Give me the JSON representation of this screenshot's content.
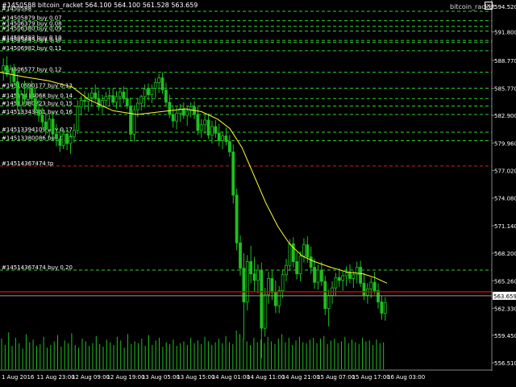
{
  "header": {
    "symbol_line": "#1450588 bitcoin_racket 564.100 564.100 561.528 563.659",
    "close_glyph": "×"
  },
  "watermark": "bitcoin_racket",
  "colors": {
    "background": "#000000",
    "candle": "#1fc01f",
    "volume": "#1fc01f",
    "moving_average": "#ffff33",
    "buy_line": "#33cc33",
    "stop_line": "#cc2222",
    "bid_line": "#d40000",
    "ask_line": "#999999",
    "order_label": "#ffffff"
  },
  "chart_data": {
    "type": "line",
    "y_ticks": [
      "594.520",
      "591.800",
      "588.770",
      "585.770",
      "582.900",
      "579.960",
      "577.020",
      "574.080",
      "571.140",
      "568.200",
      "565.260",
      "563.659",
      "562.330",
      "559.450",
      "556.510"
    ],
    "ylim": [
      556.51,
      594.52
    ],
    "x_ticks": [
      "1 Aug 2016",
      "11 Aug 23:00",
      "12 Aug 09:00",
      "12 Aug 19:00",
      "13 Aug 05:00",
      "13 Aug 15:00",
      "14 Aug 01:00",
      "14 Aug 11:00",
      "14 Aug 21:00",
      "15 Aug 07:00",
      "15 Aug 17:00",
      "16 Aug 03:00"
    ],
    "current_price": 563.659,
    "orders": [
      {
        "label": "#1450588",
        "price": 594.0
      },
      {
        "label": "#14505879 buy 0.07",
        "price": 593.0
      },
      {
        "label": "#14506379 buy 0.08",
        "price": 592.4
      },
      {
        "label": "#14506380 buy 0.09",
        "price": 591.9
      },
      {
        "label": "#14506383 buy 0.10",
        "price": 590.9
      },
      {
        "label": "#14505845 buy 0.10",
        "price": 590.7
      },
      {
        "label": "#14506982 buy 0.11",
        "price": 589.8
      },
      {
        "label": "#14506577 buy 0.12",
        "price": 587.5
      },
      {
        "label": "#14510590177 buy 0.13",
        "price": 585.8
      },
      {
        "label": "#14513414068 buy 0.14",
        "price": 584.7
      },
      {
        "label": "#14513380223 buy 0.15",
        "price": 583.9
      },
      {
        "label": "#14513343461 buy 0.16",
        "price": 583.0
      },
      {
        "label": "#14513394109 buy 0.17",
        "price": 581.1
      },
      {
        "label": "#14513380086 buy 0.18",
        "price": 580.2
      },
      {
        "label": "#14514367474 tp",
        "price": 577.5
      },
      {
        "label": "#14514367474 buy 0.20",
        "price": 566.4
      }
    ],
    "moving_average": [
      [
        0,
        587.5
      ],
      [
        30,
        587.0
      ],
      [
        60,
        586.6
      ],
      [
        90,
        585.9
      ],
      [
        110,
        584.6
      ],
      [
        140,
        583.4
      ],
      [
        170,
        583.0
      ],
      [
        200,
        583.3
      ],
      [
        230,
        583.6
      ],
      [
        250,
        583.3
      ],
      [
        270,
        582.5
      ],
      [
        285,
        581.5
      ],
      [
        300,
        579.5
      ],
      [
        315,
        576.5
      ],
      [
        330,
        573.5
      ],
      [
        345,
        571.0
      ],
      [
        360,
        569.1
      ],
      [
        375,
        567.9
      ],
      [
        390,
        567.3
      ],
      [
        410,
        566.7
      ],
      [
        430,
        566.2
      ],
      [
        450,
        566.0
      ],
      [
        465,
        565.6
      ],
      [
        480,
        565.0
      ]
    ],
    "candles": [
      [
        587.6,
        589.0,
        586.6,
        588.2
      ],
      [
        588.2,
        589.2,
        587.0,
        587.3
      ],
      [
        587.3,
        588.3,
        586.1,
        587.8
      ],
      [
        587.8,
        588.4,
        586.1,
        586.5
      ],
      [
        586.5,
        587.3,
        583.4,
        584.0
      ],
      [
        584.0,
        585.6,
        582.9,
        585.1
      ],
      [
        585.1,
        586.6,
        584.1,
        584.6
      ],
      [
        584.6,
        586.4,
        583.9,
        585.8
      ],
      [
        585.8,
        586.6,
        584.3,
        584.7
      ],
      [
        584.7,
        585.7,
        583.0,
        583.5
      ],
      [
        583.5,
        584.6,
        582.2,
        582.9
      ],
      [
        582.9,
        583.7,
        581.6,
        582.2
      ],
      [
        582.2,
        583.2,
        580.8,
        581.4
      ],
      [
        581.4,
        583.1,
        580.6,
        582.5
      ],
      [
        582.5,
        583.3,
        580.2,
        580.9
      ],
      [
        580.9,
        582.0,
        579.6,
        580.4
      ],
      [
        580.4,
        581.5,
        579.0,
        579.7
      ],
      [
        579.7,
        581.5,
        579.3,
        580.9
      ],
      [
        580.9,
        581.6,
        579.2,
        579.9
      ],
      [
        579.9,
        581.0,
        578.8,
        580.6
      ],
      [
        580.6,
        582.0,
        580.0,
        581.3
      ],
      [
        581.3,
        584.5,
        580.9,
        583.8
      ],
      [
        583.8,
        585.0,
        582.9,
        584.5
      ],
      [
        584.5,
        585.5,
        583.5,
        584.4
      ],
      [
        584.4,
        585.3,
        583.3,
        584.8
      ],
      [
        584.8,
        585.7,
        583.9,
        585.3
      ],
      [
        585.3,
        586.2,
        584.4,
        584.7
      ],
      [
        584.7,
        585.6,
        583.4,
        583.8
      ],
      [
        583.8,
        585.1,
        583.1,
        584.5
      ],
      [
        584.5,
        585.4,
        583.7,
        584.9
      ],
      [
        584.9,
        585.7,
        583.9,
        585.0
      ],
      [
        585.0,
        585.8,
        584.0,
        584.3
      ],
      [
        584.3,
        585.5,
        583.6,
        584.9
      ],
      [
        584.9,
        585.8,
        583.8,
        585.4
      ],
      [
        585.4,
        586.0,
        584.2,
        584.7
      ],
      [
        584.7,
        585.8,
        583.6,
        583.9
      ],
      [
        583.9,
        584.8,
        580.2,
        580.9
      ],
      [
        580.9,
        584.0,
        580.1,
        583.5
      ],
      [
        583.5,
        584.7,
        582.7,
        584.2
      ],
      [
        584.2,
        585.1,
        583.4,
        584.9
      ],
      [
        584.9,
        586.2,
        583.8,
        585.7
      ],
      [
        585.7,
        586.3,
        584.5,
        585.1
      ],
      [
        585.1,
        586.2,
        584.2,
        585.8
      ],
      [
        585.8,
        586.9,
        584.8,
        586.4
      ],
      [
        586.4,
        587.3,
        585.3,
        586.9
      ],
      [
        586.9,
        587.5,
        585.2,
        585.6
      ],
      [
        585.6,
        586.4,
        583.9,
        584.3
      ],
      [
        584.3,
        585.1,
        582.6,
        583.0
      ],
      [
        583.0,
        584.0,
        581.6,
        582.3
      ],
      [
        582.3,
        583.8,
        581.4,
        583.1
      ],
      [
        583.1,
        584.1,
        582.2,
        583.6
      ],
      [
        583.6,
        584.3,
        582.5,
        582.9
      ],
      [
        582.9,
        583.9,
        581.8,
        583.4
      ],
      [
        583.4,
        584.3,
        582.7,
        583.8
      ],
      [
        583.8,
        584.4,
        582.5,
        583.0
      ],
      [
        583.0,
        583.8,
        580.8,
        581.3
      ],
      [
        581.3,
        582.5,
        580.5,
        581.9
      ],
      [
        581.9,
        583.0,
        580.9,
        582.4
      ],
      [
        582.4,
        583.1,
        580.4,
        580.8
      ],
      [
        580.8,
        582.3,
        579.9,
        581.7
      ],
      [
        581.7,
        582.4,
        580.5,
        581.0
      ],
      [
        581.0,
        582.0,
        579.6,
        580.2
      ],
      [
        580.2,
        581.2,
        579.3,
        580.7
      ],
      [
        580.7,
        581.6,
        579.7,
        580.1
      ],
      [
        580.1,
        580.8,
        578.5,
        579.0
      ],
      [
        579.0,
        579.8,
        573.5,
        574.4
      ],
      [
        574.4,
        575.1,
        568.5,
        569.3
      ],
      [
        569.3,
        570.1,
        565.8,
        566.6
      ],
      [
        566.6,
        568.2,
        559.0,
        563.0
      ],
      [
        563.0,
        568.0,
        562.1,
        567.3
      ],
      [
        567.3,
        569.0,
        565.0,
        566.0
      ],
      [
        566.0,
        567.8,
        564.1,
        565.3
      ],
      [
        565.3,
        567.0,
        563.9,
        566.4
      ],
      [
        566.4,
        567.2,
        557.0,
        560.2
      ],
      [
        560.2,
        564.5,
        559.3,
        563.8
      ],
      [
        563.8,
        566.2,
        562.8,
        565.5
      ],
      [
        565.5,
        566.4,
        563.2,
        564.0
      ],
      [
        564.0,
        565.3,
        561.8,
        562.6
      ],
      [
        562.6,
        564.7,
        561.8,
        564.2
      ],
      [
        564.2,
        566.5,
        563.4,
        565.9
      ],
      [
        565.9,
        567.6,
        565.2,
        566.9
      ],
      [
        566.9,
        569.7,
        566.4,
        569.2
      ],
      [
        569.2,
        569.9,
        566.7,
        567.3
      ],
      [
        567.3,
        568.3,
        565.4,
        566.0
      ],
      [
        566.0,
        568.4,
        565.2,
        567.9
      ],
      [
        567.9,
        569.8,
        567.2,
        569.1
      ],
      [
        569.1,
        570.0,
        567.2,
        567.8
      ],
      [
        567.8,
        568.9,
        566.0,
        566.7
      ],
      [
        566.7,
        567.6,
        564.4,
        565.1
      ],
      [
        565.1,
        567.0,
        564.3,
        566.4
      ],
      [
        566.4,
        567.3,
        564.7,
        565.2
      ],
      [
        565.2,
        565.8,
        561.6,
        562.3
      ],
      [
        562.3,
        564.3,
        560.4,
        563.7
      ],
      [
        563.7,
        565.2,
        562.8,
        564.5
      ],
      [
        564.5,
        566.1,
        563.6,
        565.6
      ],
      [
        565.6,
        566.6,
        564.6,
        565.3
      ],
      [
        565.3,
        566.3,
        564.2,
        565.8
      ],
      [
        565.8,
        566.8,
        564.7,
        566.1
      ],
      [
        566.1,
        567.0,
        565.0,
        565.5
      ],
      [
        565.5,
        566.3,
        564.5,
        565.9
      ],
      [
        565.9,
        567.3,
        565.0,
        566.7
      ],
      [
        566.7,
        567.4,
        564.6,
        565.0
      ],
      [
        565.0,
        566.1,
        563.2,
        563.7
      ],
      [
        563.7,
        565.0,
        562.8,
        564.4
      ],
      [
        564.4,
        565.6,
        563.4,
        565.1
      ],
      [
        565.1,
        566.2,
        563.8,
        564.2
      ],
      [
        564.2,
        565.0,
        562.3,
        563.0
      ],
      [
        563.0,
        563.7,
        561.1,
        561.8
      ],
      [
        561.8,
        563.5,
        561.0,
        562.9
      ]
    ],
    "volumes": [
      3.4,
      2.7,
      4.1,
      2.6,
      3.5,
      2.9,
      2.3,
      3.9,
      3.0,
      3.3,
      2.6,
      2.8,
      3.6,
      2.4,
      2.7,
      3.1,
      3.8,
      2.5,
      3.2,
      2.9,
      4.0,
      2.7,
      2.4,
      3.4,
      3.1,
      2.6,
      2.9,
      3.7,
      2.8,
      2.5,
      3.3,
      3.0,
      2.7,
      3.6,
      3.2,
      2.4,
      3.9,
      2.8,
      3.1,
      2.9,
      3.4,
      2.6,
      3.8,
      2.7,
      3.2,
      3.5,
      2.5,
      3.0,
      2.8,
      3.3,
      2.6,
      2.9,
      3.1,
      2.7,
      3.5,
      2.9,
      3.2,
      2.8,
      3.6,
      3.1,
      2.7,
      3.0,
      3.4,
      2.9,
      3.7,
      3.0,
      2.8,
      4.3,
      3.9,
      3.4,
      3.1,
      2.7,
      3.5,
      3.0,
      3.3,
      2.9,
      3.6,
      3.1,
      2.8,
      3.4,
      3.9,
      3.0,
      3.5,
      2.7,
      3.2,
      3.6,
      3.0,
      2.9,
      3.3,
      3.5,
      2.9,
      3.4,
      3.7,
      2.8,
      3.2,
      3.4,
      2.9,
      3.1,
      3.6,
      2.9,
      3.3,
      3.0,
      2.8,
      3.5,
      3.1,
      3.2,
      2.7,
      3.3,
      2.9,
      3.0
    ]
  }
}
